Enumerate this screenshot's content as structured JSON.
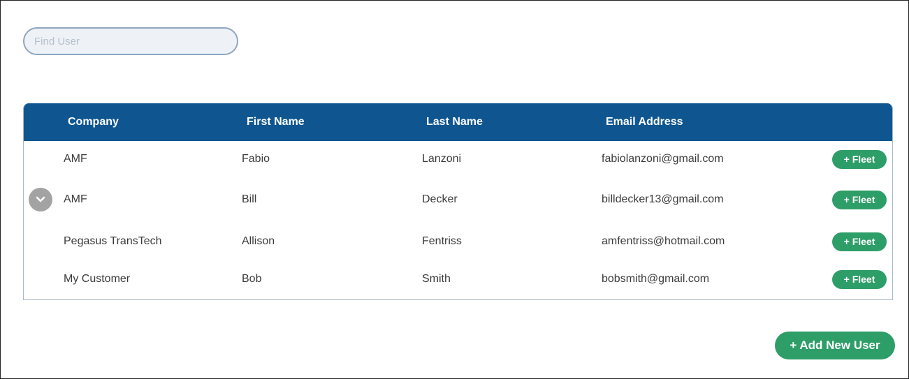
{
  "search": {
    "placeholder": "Find User",
    "value": ""
  },
  "table": {
    "headers": [
      "Company",
      "First Name",
      "Last Name",
      "Email Address"
    ],
    "rows": [
      {
        "company": "AMF",
        "first_name": "Fabio",
        "last_name": "Lanzoni",
        "email": "fabiolanzoni@gmail.com",
        "action_label": "+ Fleet",
        "expanded_icon": false
      },
      {
        "company": "AMF",
        "first_name": "Bill",
        "last_name": "Decker",
        "email": "billdecker13@gmail.com",
        "action_label": "+ Fleet",
        "expanded_icon": true
      },
      {
        "company": "Pegasus TransTech",
        "first_name": "Allison",
        "last_name": "Fentriss",
        "email": "amfentriss@hotmail.com",
        "action_label": "+ Fleet",
        "expanded_icon": false
      },
      {
        "company": "My Customer",
        "first_name": "Bob",
        "last_name": "Smith",
        "email": "bobsmith@gmail.com",
        "action_label": "+ Fleet",
        "expanded_icon": false
      }
    ]
  },
  "actions": {
    "add_user_label": "+ Add New User"
  },
  "icons": {
    "expand": "chevron-down-icon"
  },
  "colors": {
    "header_bg": "#0f5690",
    "button_green": "#2e9e68",
    "expand_gray": "#a3a3a3"
  }
}
